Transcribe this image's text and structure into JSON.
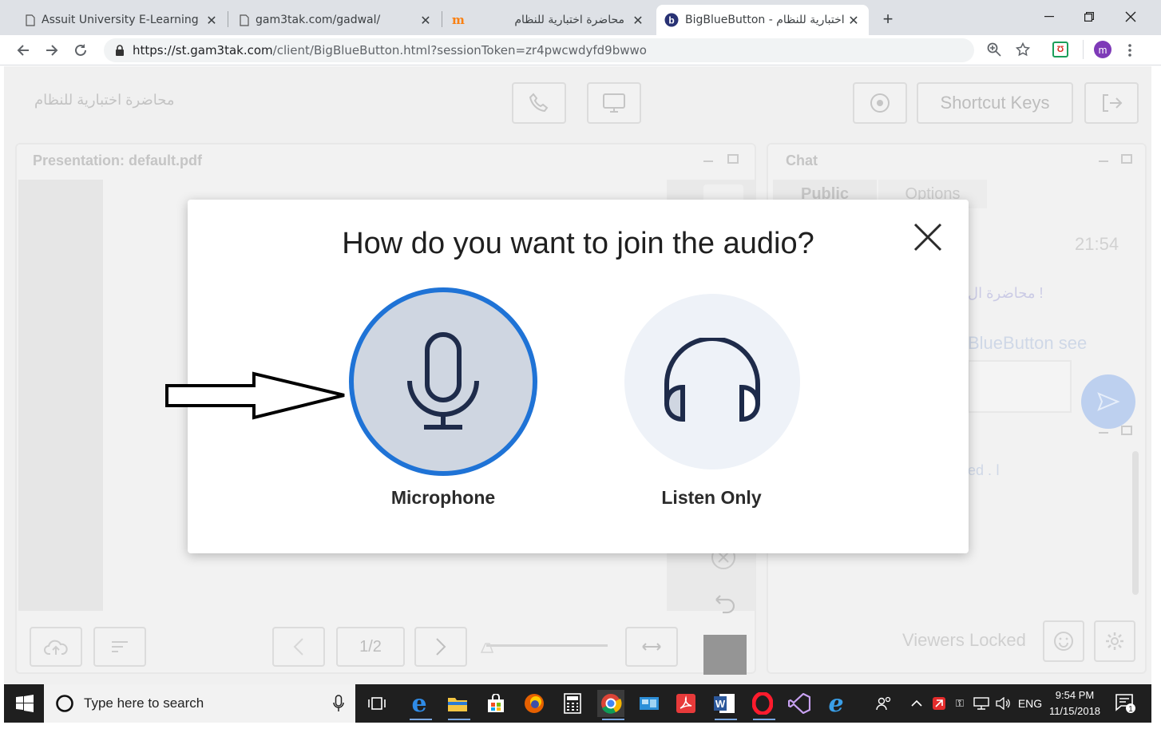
{
  "browser": {
    "tabs": [
      {
        "title": "Assuit University E-Learning",
        "close": "✕"
      },
      {
        "title": "gam3tak.com/gadwal/",
        "close": "✕"
      },
      {
        "title": "محاضرة اختبارية للنظام",
        "close": "✕"
      },
      {
        "title": "BigBlueButton - رة اختبارية للنظام",
        "close": "✕"
      }
    ],
    "new_tab": "+",
    "url": "https://st.gam3tak.com/client/BigBlueButton.html?sessionToken=zr4pwcwdyfd9bwwo",
    "url_host": "https://st.gam3tak.com",
    "url_path": "/client/BigBlueButton.html?sessionToken=zr4pwcwdyfd9bwwo",
    "profile_initial": "m"
  },
  "app": {
    "meeting_title": "محاضرة اختبارية للنظام",
    "shortcut_keys": "Shortcut Keys",
    "presentation_title": "Presentation: default.pdf",
    "slide_counter": "1/2",
    "chat_title": "Chat",
    "chat_tabs": [
      "Public",
      "Options"
    ],
    "chat_time": "21:54",
    "chat_msg1": "محاضرة ال !",
    "chat_msg2": "BlueButton see",
    "users_fragment": "ed . ا",
    "viewers_locked": "Viewers Locked"
  },
  "modal": {
    "title": "How do you want to join the audio?",
    "microphone": "Microphone",
    "listen_only": "Listen Only"
  },
  "taskbar": {
    "search_placeholder": "Type here to search",
    "lang": "ENG",
    "time": "9:54 PM",
    "date": "11/15/2018",
    "notifications": "1"
  },
  "colors": {
    "accent": "#1a73e8",
    "mic_ring": "#1f73d6",
    "mic_fill": "#cfd6e1",
    "listen_fill": "#eef2f8",
    "icon_dark": "#1e2b4a"
  }
}
